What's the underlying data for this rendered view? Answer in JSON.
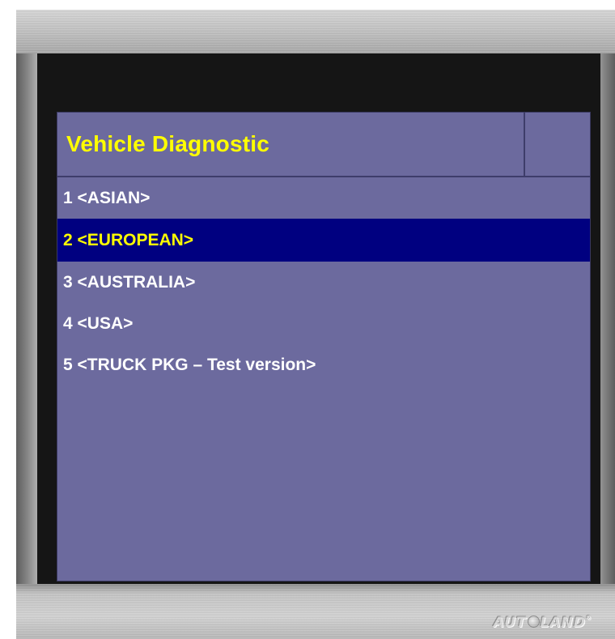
{
  "screen": {
    "title": "Vehicle Diagnostic",
    "selected_index": 1,
    "menu_items": [
      {
        "label": "1 <ASIAN>"
      },
      {
        "label": "2 <EUROPEAN>"
      },
      {
        "label": "3 <AUSTRALIA>"
      },
      {
        "label": "4 <USA>"
      },
      {
        "label": "5 <TRUCK PKG – Test version>"
      }
    ]
  },
  "device": {
    "logo": {
      "prefix": "AUT",
      "suffix": "LAND",
      "full": "AUTOLAND"
    }
  },
  "colors": {
    "screen_background": "#6c6a9e",
    "title_text": "#ffff00",
    "item_text": "#ffffff",
    "selected_background": "#000080",
    "selected_text": "#ffff00"
  }
}
